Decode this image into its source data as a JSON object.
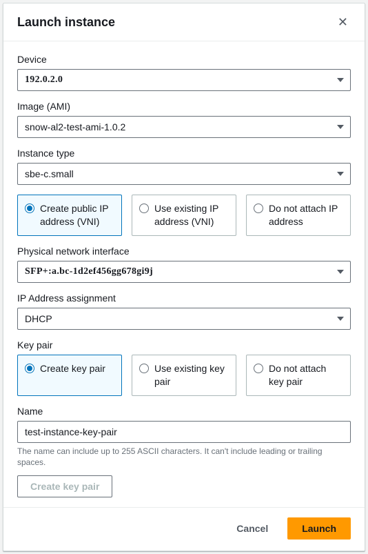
{
  "header": {
    "title": "Launch instance"
  },
  "fields": {
    "device": {
      "label": "Device",
      "value": "192.0.2.0"
    },
    "image": {
      "label": "Image (AMI)",
      "value": "snow-al2-test-ami-1.0.2"
    },
    "instanceType": {
      "label": "Instance type",
      "value": "sbe-c.small"
    },
    "ipOptions": {
      "items": [
        {
          "label": "Create public IP address (VNI)",
          "selected": true
        },
        {
          "label": "Use existing IP address (VNI)",
          "selected": false
        },
        {
          "label": "Do not attach IP address",
          "selected": false
        }
      ]
    },
    "physicalNetwork": {
      "label": "Physical network interface",
      "value": "SFP+:a.bc-1d2ef456gg678gi9j"
    },
    "ipAssignment": {
      "label": "IP Address assignment",
      "value": "DHCP"
    },
    "keyPair": {
      "label": "Key pair",
      "items": [
        {
          "label": "Create key pair",
          "selected": true
        },
        {
          "label": "Use existing key pair",
          "selected": false
        },
        {
          "label": "Do not attach key pair",
          "selected": false
        }
      ]
    },
    "name": {
      "label": "Name",
      "value": "test-instance-key-pair",
      "hint": "The name can include up to 255 ASCII characters. It can't include leading or trailing spaces."
    },
    "createKeyPair": {
      "label": "Create key pair"
    }
  },
  "footer": {
    "cancel": "Cancel",
    "launch": "Launch"
  }
}
